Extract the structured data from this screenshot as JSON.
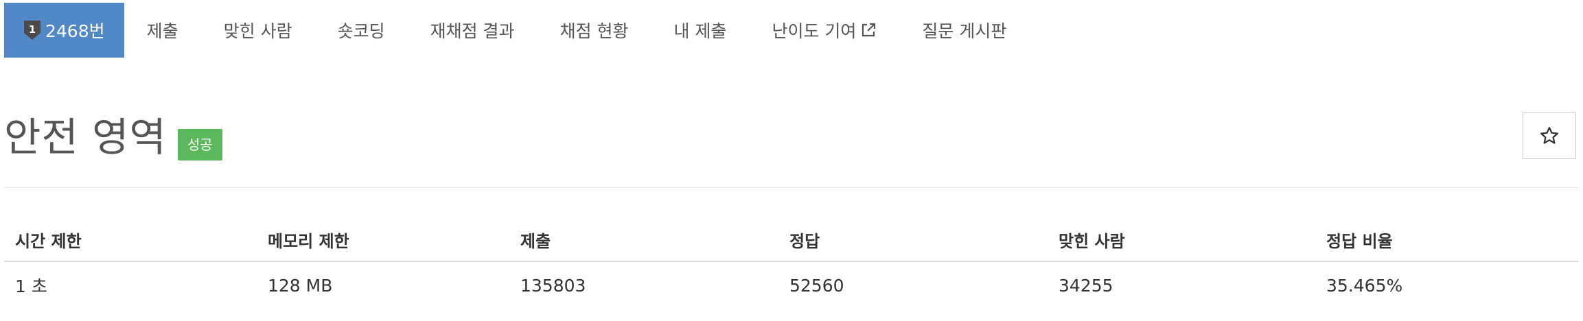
{
  "tabs": [
    {
      "label": "2468번",
      "tier": "1",
      "active": true
    },
    {
      "label": "제출"
    },
    {
      "label": "맞힌 사람"
    },
    {
      "label": "숏코딩"
    },
    {
      "label": "재채점 결과"
    },
    {
      "label": "채점 현황"
    },
    {
      "label": "내 제출"
    },
    {
      "label": "난이도 기여",
      "external": true
    },
    {
      "label": "질문 게시판"
    }
  ],
  "problem": {
    "title": "안전 영역",
    "status_badge": "성공",
    "favorite_icon": "star-outline-icon"
  },
  "info_table": {
    "headers": [
      "시간 제한",
      "메모리 제한",
      "제출",
      "정답",
      "맞힌 사람",
      "정답 비율"
    ],
    "row": [
      "1 초",
      "128 MB",
      "135803",
      "52560",
      "34255",
      "35.465%"
    ]
  },
  "colors": {
    "active_tab": "#5188c8",
    "success_badge": "#5cb85c",
    "tier_badge": "#4a4a4a"
  }
}
